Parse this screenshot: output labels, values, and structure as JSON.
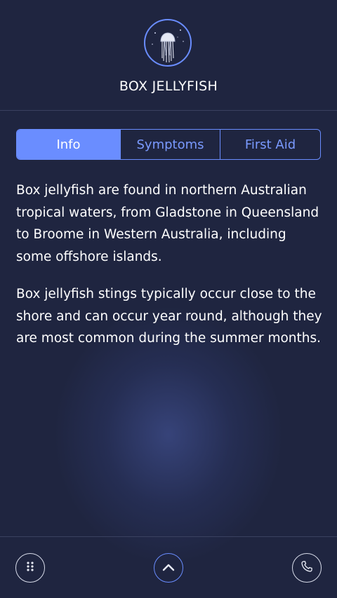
{
  "header": {
    "title": "BOX JELLYFISH",
    "logo_icon": "jellyfish-icon"
  },
  "tabs": [
    {
      "label": "Info",
      "active": true
    },
    {
      "label": "Symptoms",
      "active": false
    },
    {
      "label": "First Aid",
      "active": false
    }
  ],
  "content": {
    "paragraphs": [
      "Box jellyfish are found in northern Australian tropical waters, from Gladstone in Queensland to Broome in Western Australia, including some offshore islands.",
      "Box jellyfish stings typically occur close to the shore and can occur year round, although they are most common during the summer months."
    ]
  },
  "footer": {
    "menu_icon": "grid-dots-icon",
    "up_icon": "chevron-up-icon",
    "call_icon": "phone-icon"
  },
  "colors": {
    "background": "#1f2540",
    "accent": "#6a8dff",
    "text": "#ffffff",
    "divider": "#3a4160"
  }
}
